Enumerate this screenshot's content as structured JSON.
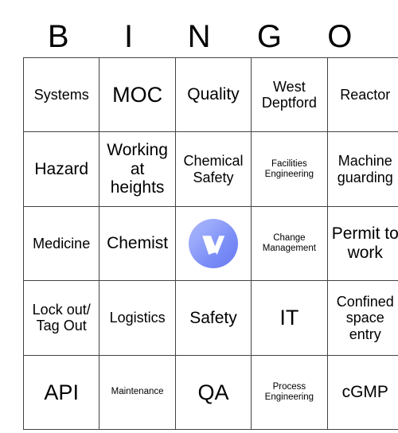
{
  "card": {
    "header_letters": [
      "B",
      "I",
      "N",
      "G",
      "O"
    ],
    "rows": [
      [
        {
          "text": "Systems",
          "size": "md"
        },
        {
          "text": "MOC",
          "size": "xl"
        },
        {
          "text": "Quality",
          "size": "lg"
        },
        {
          "text": "West Deptford",
          "size": "md"
        },
        {
          "text": "Reactor",
          "size": "md"
        }
      ],
      [
        {
          "text": "Hazard",
          "size": "lg"
        },
        {
          "text": "Working at heights",
          "size": "lg"
        },
        {
          "text": "Chemical Safety",
          "size": "md"
        },
        {
          "text": "Facilities Engineering",
          "size": "sm"
        },
        {
          "text": "Machine guarding",
          "size": "md"
        }
      ],
      [
        {
          "text": "Medicine",
          "size": "md"
        },
        {
          "text": "Chemist",
          "size": "lg"
        },
        {
          "text": "",
          "size": "md",
          "free_space": true,
          "logo": "veeva-v-logo"
        },
        {
          "text": "Change Management",
          "size": "sm"
        },
        {
          "text": "Permit to work",
          "size": "lg"
        }
      ],
      [
        {
          "text": "Lock out/ Tag Out",
          "size": "md"
        },
        {
          "text": "Logistics",
          "size": "md"
        },
        {
          "text": "Safety",
          "size": "lg"
        },
        {
          "text": "IT",
          "size": "xl"
        },
        {
          "text": "Confined space entry",
          "size": "md"
        }
      ],
      [
        {
          "text": "API",
          "size": "xl"
        },
        {
          "text": "Maintenance",
          "size": "sm"
        },
        {
          "text": "QA",
          "size": "xl"
        },
        {
          "text": "Process Engineering",
          "size": "sm"
        },
        {
          "text": "cGMP",
          "size": "lg"
        }
      ]
    ],
    "colors": {
      "border": "#434343",
      "text": "#000000",
      "background": "#ffffff",
      "logo_gradient_start": "#a7b4fb",
      "logo_gradient_end": "#6979f2",
      "logo_glyph": "#ffffff"
    }
  }
}
